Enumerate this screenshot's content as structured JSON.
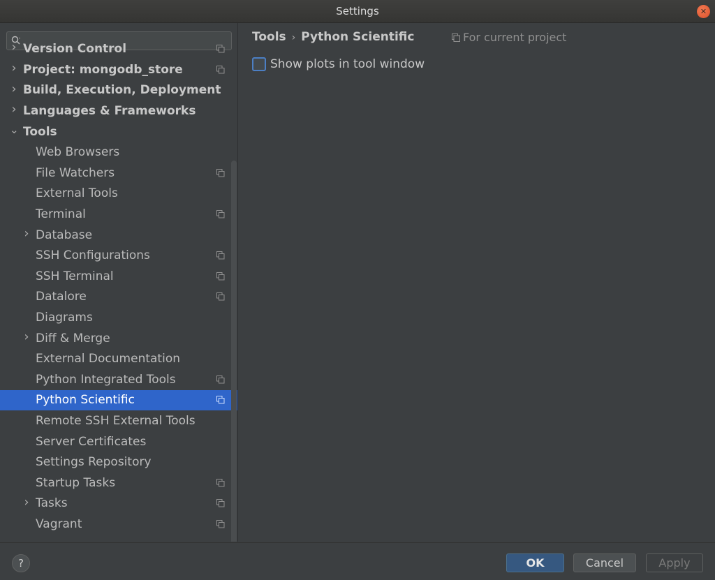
{
  "window": {
    "title": "Settings"
  },
  "sidebar": {
    "search_placeholder": "",
    "tree": [
      {
        "label": "Version Control",
        "level": 0,
        "arrow": "right",
        "bold": true,
        "project_icon": true,
        "clipped": true
      },
      {
        "label": "Project: mongodb_store",
        "level": 0,
        "arrow": "right",
        "bold": true,
        "project_icon": true
      },
      {
        "label": "Build, Execution, Deployment",
        "level": 0,
        "arrow": "right",
        "bold": true,
        "project_icon": false
      },
      {
        "label": "Languages & Frameworks",
        "level": 0,
        "arrow": "right",
        "bold": true,
        "project_icon": false
      },
      {
        "label": "Tools",
        "level": 0,
        "arrow": "down",
        "bold": true,
        "project_icon": false
      },
      {
        "label": "Web Browsers",
        "level": 1,
        "arrow": "",
        "bold": false,
        "project_icon": false
      },
      {
        "label": "File Watchers",
        "level": 1,
        "arrow": "",
        "bold": false,
        "project_icon": true
      },
      {
        "label": "External Tools",
        "level": 1,
        "arrow": "",
        "bold": false,
        "project_icon": false
      },
      {
        "label": "Terminal",
        "level": 1,
        "arrow": "",
        "bold": false,
        "project_icon": true
      },
      {
        "label": "Database",
        "level": 1,
        "arrow": "right",
        "bold": false,
        "project_icon": false
      },
      {
        "label": "SSH Configurations",
        "level": 1,
        "arrow": "",
        "bold": false,
        "project_icon": true
      },
      {
        "label": "SSH Terminal",
        "level": 1,
        "arrow": "",
        "bold": false,
        "project_icon": true
      },
      {
        "label": "Datalore",
        "level": 1,
        "arrow": "",
        "bold": false,
        "project_icon": true
      },
      {
        "label": "Diagrams",
        "level": 1,
        "arrow": "",
        "bold": false,
        "project_icon": false
      },
      {
        "label": "Diff & Merge",
        "level": 1,
        "arrow": "right",
        "bold": false,
        "project_icon": false
      },
      {
        "label": "External Documentation",
        "level": 1,
        "arrow": "",
        "bold": false,
        "project_icon": false
      },
      {
        "label": "Python Integrated Tools",
        "level": 1,
        "arrow": "",
        "bold": false,
        "project_icon": true
      },
      {
        "label": "Python Scientific",
        "level": 1,
        "arrow": "",
        "bold": false,
        "project_icon": true,
        "selected": true
      },
      {
        "label": "Remote SSH External Tools",
        "level": 1,
        "arrow": "",
        "bold": false,
        "project_icon": false
      },
      {
        "label": "Server Certificates",
        "level": 1,
        "arrow": "",
        "bold": false,
        "project_icon": false
      },
      {
        "label": "Settings Repository",
        "level": 1,
        "arrow": "",
        "bold": false,
        "project_icon": false
      },
      {
        "label": "Startup Tasks",
        "level": 1,
        "arrow": "",
        "bold": false,
        "project_icon": true
      },
      {
        "label": "Tasks",
        "level": 1,
        "arrow": "right",
        "bold": false,
        "project_icon": true
      },
      {
        "label": "Vagrant",
        "level": 1,
        "arrow": "",
        "bold": false,
        "project_icon": true
      }
    ]
  },
  "content": {
    "breadcrumb": {
      "parent": "Tools",
      "separator": "›",
      "current": "Python Scientific"
    },
    "scope_label": "For current project",
    "options": {
      "show_plots_label": "Show plots in tool window",
      "show_plots_checked": false
    }
  },
  "footer": {
    "help_label": "?",
    "ok_label": "OK",
    "cancel_label": "Cancel",
    "apply_label": "Apply"
  },
  "colors": {
    "selection": "#2f65ca",
    "background": "#3c3f41",
    "ok_button": "#365880"
  }
}
